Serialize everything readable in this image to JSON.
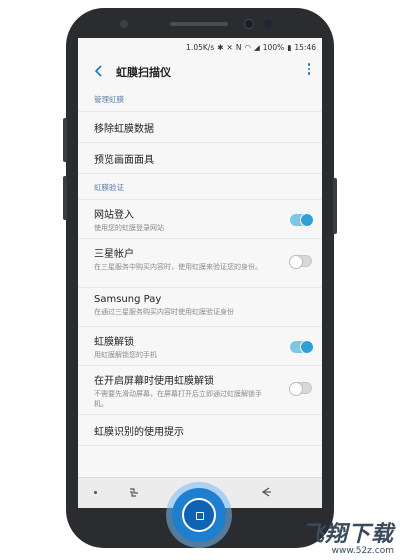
{
  "status_bar": {
    "speed": "1.05K/s",
    "battery": "100%",
    "time": "15:46"
  },
  "header": {
    "title": "虹膜扫描仪"
  },
  "sections": [
    {
      "title": "管理虹膜",
      "items": [
        {
          "label": "移除虹膜数据"
        },
        {
          "label": "预览画面面具"
        }
      ]
    },
    {
      "title": "虹膜验证",
      "items": [
        {
          "label": "网站登入",
          "desc": "使用您的虹膜登录网站",
          "toggle": "on"
        },
        {
          "label": "三星帐户",
          "desc": "在三星服务中购买内容时，使用虹膜来验证您的身份。",
          "toggle": "off"
        },
        {
          "label": "Samsung Pay",
          "desc": "在通过三星服务购买内容时使用虹膜验证身份"
        },
        {
          "label": "虹膜解锁",
          "desc": "用虹膜解锁您的手机",
          "toggle": "on"
        },
        {
          "label": "在开启屏幕时使用虹膜解锁",
          "desc": "不需要先滑动屏幕，在屏幕打开后立即通过虹膜解锁手机。",
          "toggle": "off"
        },
        {
          "label": "虹膜识别的使用提示"
        }
      ]
    }
  ],
  "watermark": {
    "brand": "飞翔下载",
    "url": "www.52z.com"
  },
  "colors": {
    "toggle_on": "#2f9fd6",
    "accent": "#1a73c8",
    "home_button": "#1e7fd0"
  }
}
